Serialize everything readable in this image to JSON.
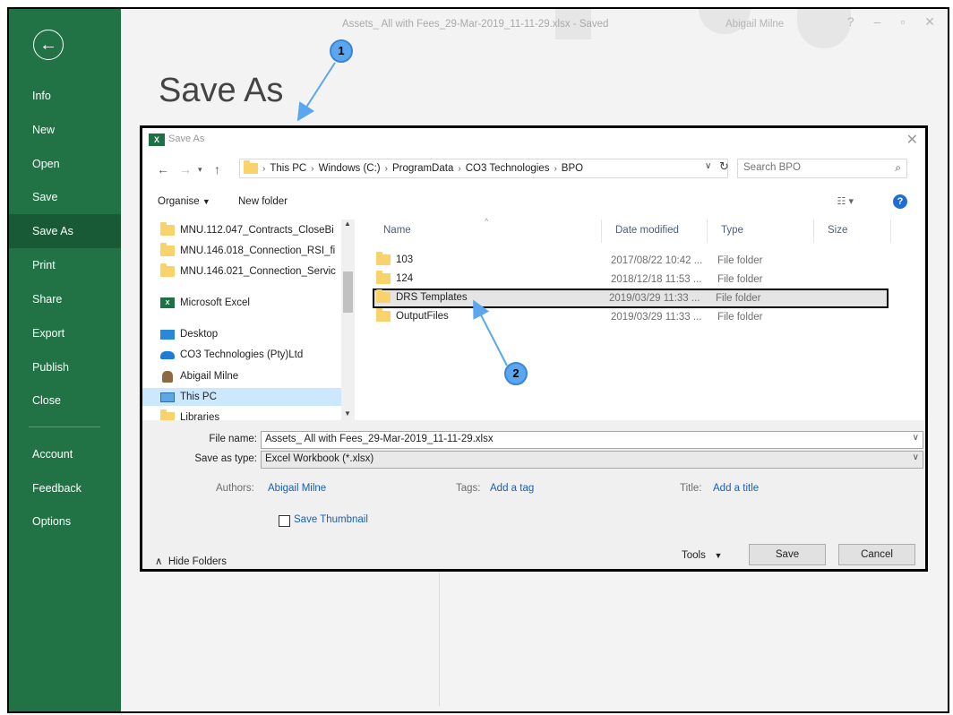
{
  "window": {
    "doc_title": "Assets_ All with Fees_29-Mar-2019_11-11-29.xlsx - Saved",
    "user": "Abigail Milne"
  },
  "sidebar": {
    "back_icon": "back-arrow-icon",
    "items": [
      {
        "label": "Info"
      },
      {
        "label": "New"
      },
      {
        "label": "Open"
      },
      {
        "label": "Save"
      },
      {
        "label": "Save As",
        "active": true
      },
      {
        "label": "Print"
      },
      {
        "label": "Share"
      },
      {
        "label": "Export"
      },
      {
        "label": "Publish"
      },
      {
        "label": "Close"
      },
      {
        "label": "Account"
      },
      {
        "label": "Feedback"
      },
      {
        "label": "Options"
      }
    ]
  },
  "page_heading": "Save As",
  "dialog": {
    "title": "Save As",
    "breadcrumb": [
      "This PC",
      "Windows (C:)",
      "ProgramData",
      "CO3 Technologies",
      "BPO"
    ],
    "search_placeholder": "Search BPO",
    "toolbar": {
      "organise": "Organise",
      "new_folder": "New folder"
    },
    "nav_tree": [
      {
        "label": "MNU.112.047_Contracts_CloseBi",
        "icon": "folder-icon"
      },
      {
        "label": "MNU.146.018_Connection_RSI_fi",
        "icon": "folder-icon"
      },
      {
        "label": "MNU.146.021_Connection_Servic",
        "icon": "folder-icon"
      },
      {
        "label": "Microsoft Excel",
        "icon": "excel-icon"
      },
      {
        "label": "Desktop",
        "icon": "desktop-icon"
      },
      {
        "label": "CO3 Technologies (Pty)Ltd",
        "icon": "onedrive-icon"
      },
      {
        "label": "Abigail Milne",
        "icon": "user-icon"
      },
      {
        "label": "This PC",
        "icon": "pc-icon",
        "selected": true
      },
      {
        "label": "Libraries",
        "icon": "folder-icon"
      }
    ],
    "columns": {
      "name": "Name",
      "date": "Date modified",
      "type": "Type",
      "size": "Size"
    },
    "files": [
      {
        "name": "103",
        "date": "2017/08/22 10:42 ...",
        "type": "File folder"
      },
      {
        "name": "124",
        "date": "2018/12/18 11:53 ...",
        "type": "File folder"
      },
      {
        "name": "DRS Templates",
        "date": "2019/03/29 11:33 ...",
        "type": "File folder",
        "highlight": true
      },
      {
        "name": "OutputFiles",
        "date": "2019/03/29 11:33 ...",
        "type": "File folder"
      }
    ],
    "form": {
      "file_name_label": "File name:",
      "file_name_value": "Assets_ All with Fees_29-Mar-2019_11-11-29.xlsx",
      "save_type_label": "Save as type:",
      "save_type_value": "Excel Workbook (*.xlsx)",
      "authors_label": "Authors:",
      "authors_value": "Abigail Milne",
      "tags_label": "Tags:",
      "tags_value": "Add a tag",
      "title_label": "Title:",
      "title_value": "Add a title",
      "thumbnail_label": "Save Thumbnail",
      "thumbnail_checked": false
    },
    "footer": {
      "hide_folders": "Hide Folders",
      "tools": "Tools",
      "save": "Save",
      "cancel": "Cancel"
    }
  },
  "callouts": [
    "1",
    "2"
  ],
  "colors": {
    "excel_green": "#217346",
    "callout_blue": "#5aa7f0",
    "link_blue": "#1a5fb4"
  }
}
